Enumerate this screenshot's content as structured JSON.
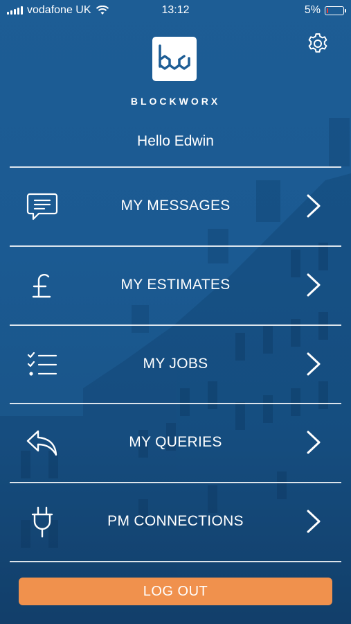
{
  "status_bar": {
    "carrier": "vodafone UK",
    "time": "13:12",
    "battery_percent": "5%",
    "battery_level": 0.05,
    "signal_icon": "signal-bars-icon",
    "wifi_icon": "wifi-icon",
    "battery_icon": "battery-icon"
  },
  "header": {
    "brand": "BLOCKWORX",
    "logo_icon": "blockworx-logo-icon",
    "settings_icon": "gear-icon",
    "greeting": "Hello Edwin"
  },
  "menu": {
    "items": [
      {
        "label": "MY MESSAGES",
        "icon": "message-icon"
      },
      {
        "label": "MY ESTIMATES",
        "icon": "pound-icon"
      },
      {
        "label": "MY JOBS",
        "icon": "checklist-icon"
      },
      {
        "label": "MY QUERIES",
        "icon": "reply-icon"
      },
      {
        "label": "PM CONNECTIONS",
        "icon": "plug-icon"
      }
    ],
    "chevron_icon": "chevron-right-icon"
  },
  "footer": {
    "logout_label": "LOG OUT"
  },
  "colors": {
    "background": "#1d5d95",
    "logout_button": "#f0914d",
    "logo_mark": "#1d5d95",
    "text": "#ffffff"
  }
}
